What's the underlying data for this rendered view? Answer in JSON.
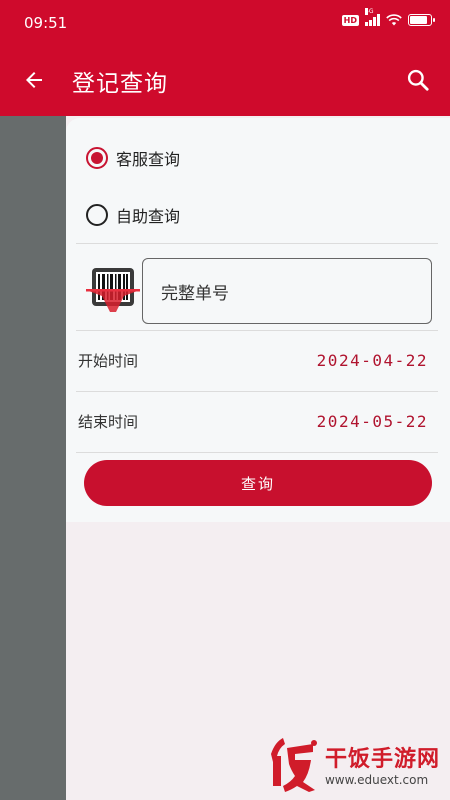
{
  "status_bar": {
    "time": "09:51",
    "hd_badge": "HD",
    "network": "5G",
    "battery_level": 0.85
  },
  "app_bar": {
    "title": "登记查询",
    "back_icon": "arrow-left-icon",
    "search_icon": "search-icon"
  },
  "query_type": {
    "options": [
      {
        "label": "客服查询",
        "selected": true
      },
      {
        "label": "自助查询",
        "selected": false
      }
    ]
  },
  "order_input": {
    "placeholder": "完整单号",
    "value": ""
  },
  "barcode_icon": "barcode-scan-icon",
  "start_time": {
    "label": "开始时间",
    "value": "2024-04-22"
  },
  "end_time": {
    "label": "结束时间",
    "value": "2024-05-22"
  },
  "query_button": {
    "label": "查询"
  },
  "watermark": {
    "brand": "干饭手游网",
    "url": "www.eduext.com",
    "logo_icon": "fan-logo-icon"
  },
  "colors": {
    "primary": "#cf0a2c",
    "accent": "#c8102e",
    "date_text": "#b0142f",
    "side_strip": "#676c6c"
  }
}
